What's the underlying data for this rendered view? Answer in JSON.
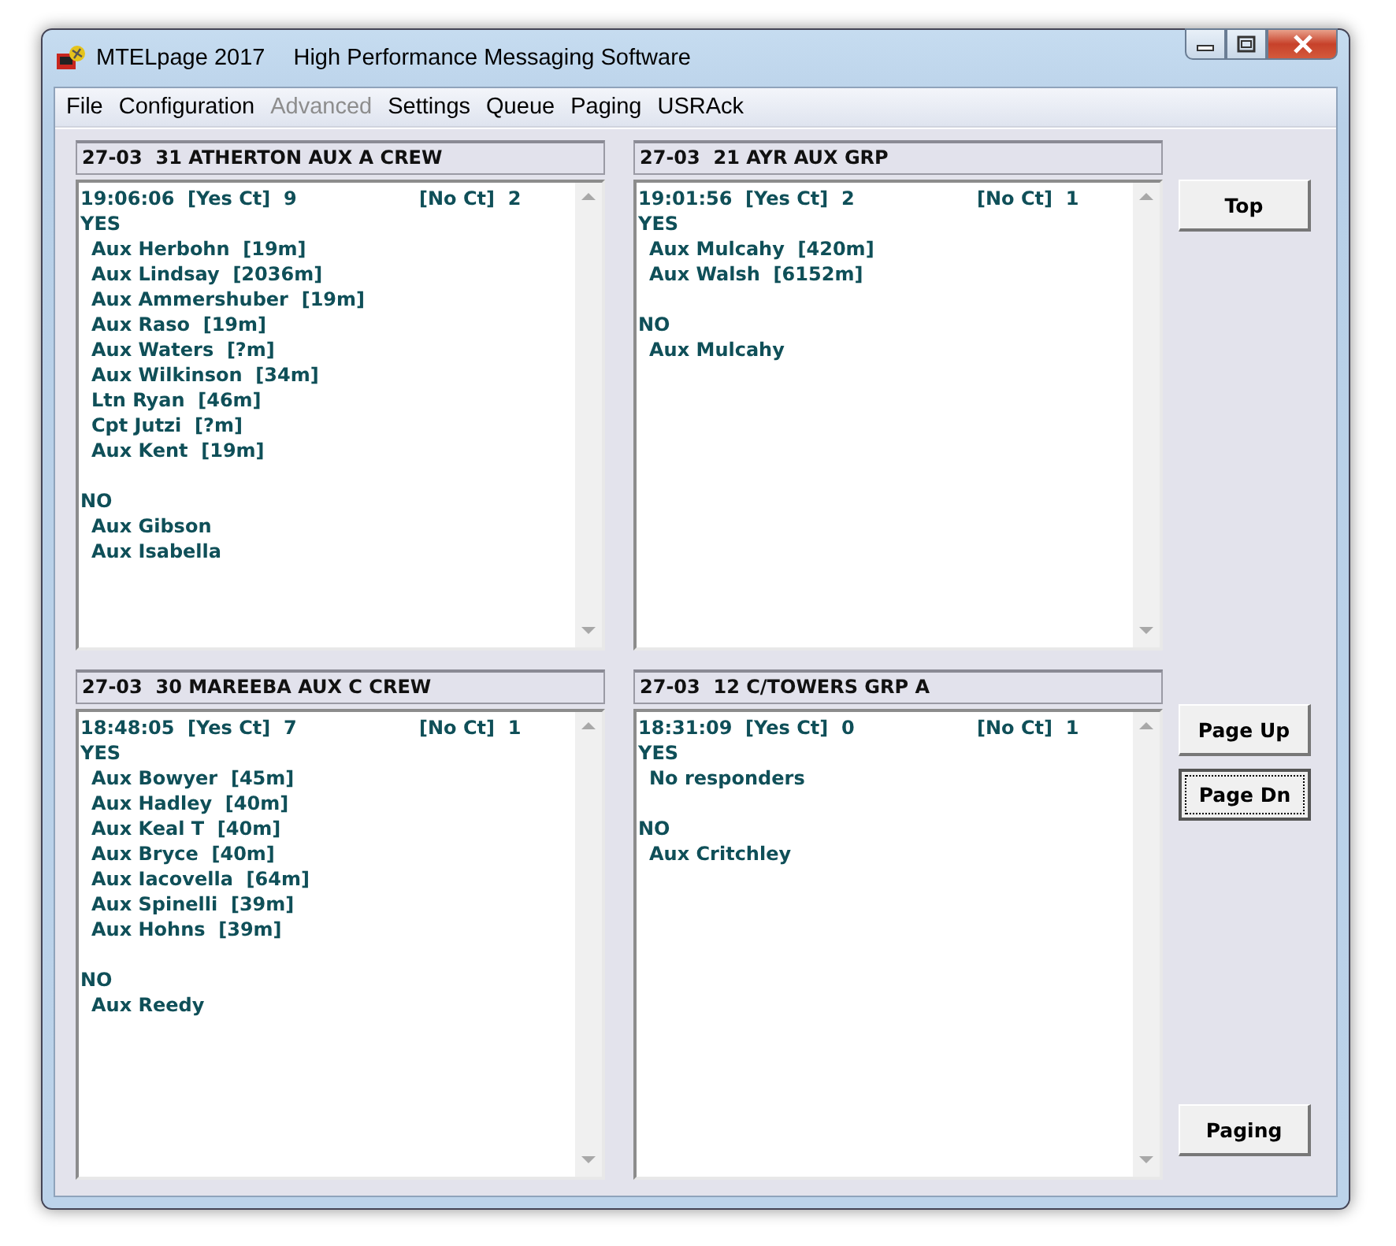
{
  "window": {
    "title": "MTELpage 2017",
    "subtitle": "High Performance Messaging Software"
  },
  "menu": [
    {
      "label": "File",
      "disabled": false
    },
    {
      "label": "Configuration",
      "disabled": false
    },
    {
      "label": "Advanced",
      "disabled": true
    },
    {
      "label": "Settings",
      "disabled": false
    },
    {
      "label": "Queue",
      "disabled": false
    },
    {
      "label": "Paging",
      "disabled": false
    },
    {
      "label": "USRAck",
      "disabled": false
    }
  ],
  "panels": [
    {
      "header": "27-03  31 ATHERTON AUX A CREW",
      "summary": "19:06:06  [Yes Ct]  9",
      "no_summary": "[No Ct]  2",
      "yes_heading": "YES",
      "yes": [
        "Aux Herbohn  [19m]",
        "Aux Lindsay  [2036m]",
        "Aux Ammershuber  [19m]",
        "Aux Raso  [19m]",
        "Aux Waters  [?m]",
        "Aux Wilkinson  [34m]",
        "Ltn Ryan  [46m]",
        "Cpt Jutzi  [?m]",
        "Aux Kent  [19m]"
      ],
      "no_heading": "NO",
      "no": [
        "Aux Gibson",
        "Aux Isabella"
      ]
    },
    {
      "header": "27-03  21 AYR AUX GRP",
      "summary": "19:01:56  [Yes Ct]  2",
      "no_summary": "[No Ct]  1",
      "yes_heading": "YES",
      "yes": [
        "Aux Mulcahy  [420m]",
        "Aux Walsh  [6152m]"
      ],
      "no_heading": "NO",
      "no": [
        "Aux Mulcahy"
      ]
    },
    {
      "header": "27-03  30 MAREEBA AUX C CREW",
      "summary": "18:48:05  [Yes Ct]  7",
      "no_summary": "[No Ct]  1",
      "yes_heading": "YES",
      "yes": [
        "Aux Bowyer  [45m]",
        "Aux Hadley  [40m]",
        "Aux Keal T  [40m]",
        "Aux Bryce  [40m]",
        "Aux Iacovella  [64m]",
        "Aux Spinelli  [39m]",
        "Aux Hohns  [39m]"
      ],
      "no_heading": "NO",
      "no": [
        "Aux Reedy"
      ]
    },
    {
      "header": "27-03  12 C/TOWERS GRP A",
      "summary": "18:31:09  [Yes Ct]  0",
      "no_summary": "[No Ct]  1",
      "yes_heading": "YES",
      "yes": [
        "No responders"
      ],
      "no_heading": "NO",
      "no": [
        "Aux Critchley"
      ]
    }
  ],
  "top_buttons": [
    {
      "label": "Top",
      "focused": false
    }
  ],
  "page_buttons": [
    {
      "label": "Page Up",
      "focused": false
    },
    {
      "label": "Page Dn",
      "focused": true
    }
  ],
  "bottom_buttons": [
    {
      "label": "Paging",
      "focused": false
    }
  ]
}
